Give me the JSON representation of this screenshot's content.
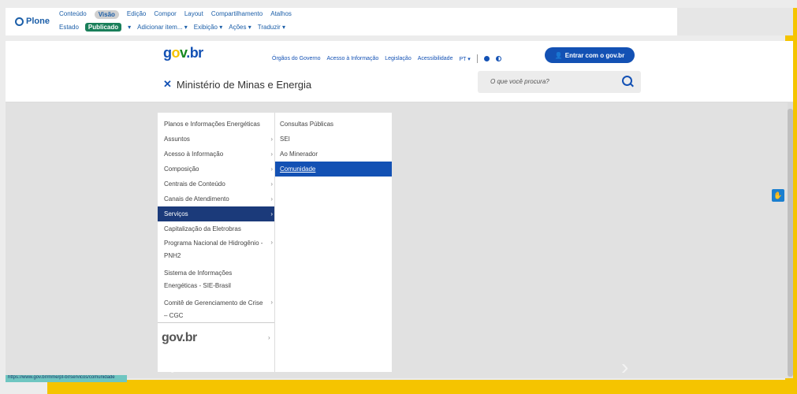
{
  "plone": {
    "logo_text": "Plone",
    "row1": [
      "Conteúdo",
      "Visão",
      "Edição",
      "Compor",
      "Layout",
      "Compartilhamento",
      "Atalhos"
    ],
    "active_row1": "Visão",
    "state_label": "Estado",
    "state_value": "Publicado",
    "row2": [
      "Adicionar item...",
      "Exibição",
      "Ações",
      "Traduzir"
    ]
  },
  "gov": {
    "logo": {
      "g1": "g",
      "g2": "o",
      "g3": "v",
      "g4": ".br"
    },
    "links": [
      "Órgãos do Governo",
      "Acesso à Informação",
      "Legislação",
      "Acessibilidade"
    ],
    "lang": "PT",
    "login_label": "Entrar com o gov.br",
    "site_title": "Ministério de Minas e Energia",
    "search_placeholder": "O que você procura?"
  },
  "menu": {
    "col1": [
      {
        "label": "Planos e Informações Energéticas",
        "chev": false
      },
      {
        "label": "Assuntos",
        "chev": true
      },
      {
        "label": "Acesso à Informação",
        "chev": true
      },
      {
        "label": "Composição",
        "chev": true
      },
      {
        "label": "Centrais de Conteúdo",
        "chev": true
      },
      {
        "label": "Canais de Atendimento",
        "chev": true
      },
      {
        "label": "Serviços",
        "chev": true,
        "active": true
      },
      {
        "label": "Capitalização da Eletrobras",
        "chev": false
      },
      {
        "label": "Programa Nacional de Hidrogênio - PNH2",
        "chev": true
      },
      {
        "label": "Sistema de Informações Energéticas - SIE-Brasil",
        "chev": false
      },
      {
        "label": "Comitê de Gerenciamento de Crise – CGC",
        "chev": true
      }
    ],
    "col2": [
      {
        "label": "Consultas Públicas"
      },
      {
        "label": "SEI"
      },
      {
        "label": "Ao Minerador"
      },
      {
        "label": "Comunidade",
        "active": true
      }
    ],
    "footer_logo": "gov.br"
  },
  "status_url": "https://www.gov.br/mme/pt-br/servicos/comunidade",
  "colors": {
    "gov_blue": "#1351b4",
    "yellow": "#f5c400",
    "green": "#168821",
    "active_nav": "#1b3a7a"
  }
}
